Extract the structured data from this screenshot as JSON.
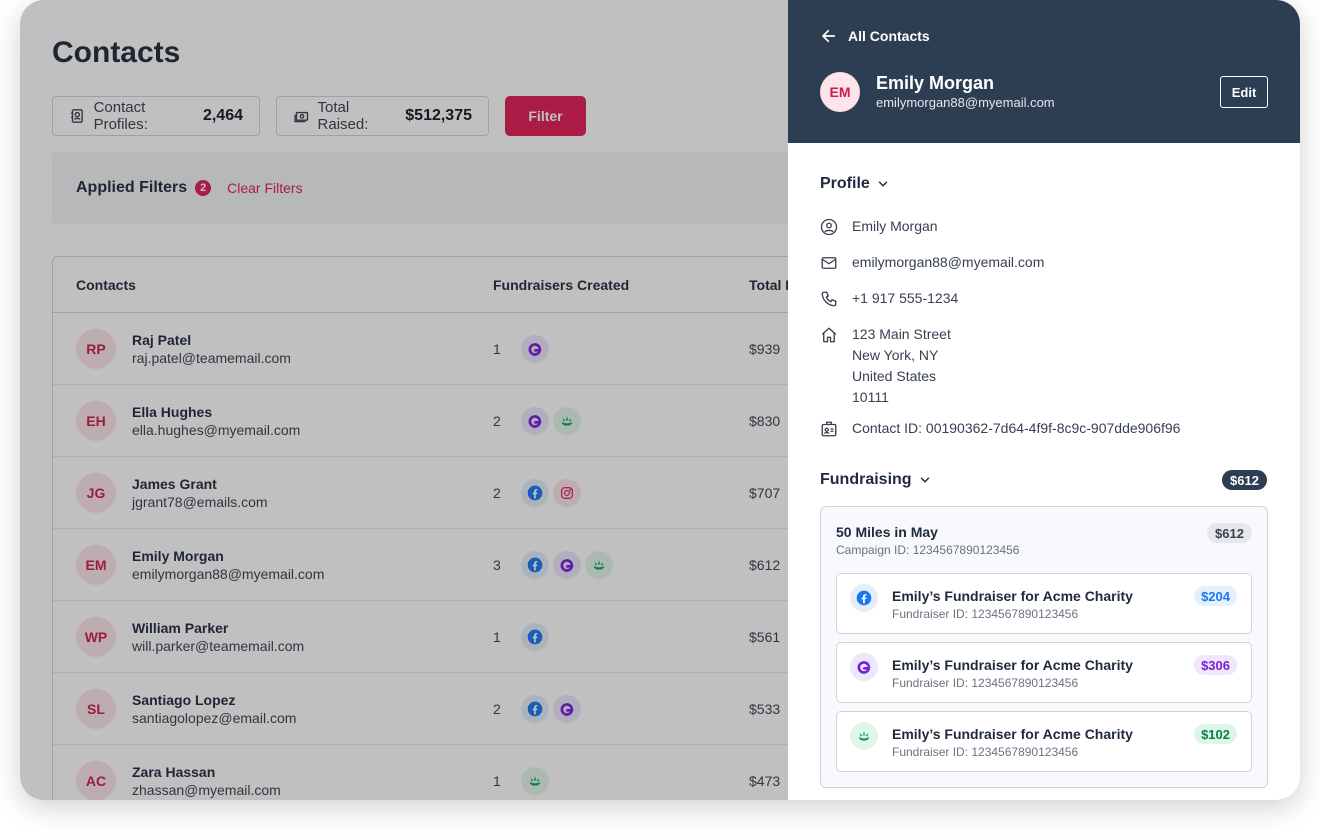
{
  "page": {
    "title": "Contacts",
    "stats": {
      "profiles_label": "Contact Profiles:",
      "profiles_value": "2,464",
      "raised_label": "Total Raised:",
      "raised_value": "$512,375"
    },
    "filter_button": "Filter",
    "applied_filters": {
      "label": "Applied Filters",
      "count": "2",
      "clear": "Clear Filters"
    },
    "table": {
      "headers": {
        "contacts": "Contacts",
        "fundraisers": "Fundraisers Created",
        "total": "Total R"
      },
      "rows": [
        {
          "initials": "RP",
          "name": "Raj Patel",
          "email": "raj.patel@teamemail.com",
          "count": "1",
          "platforms": [
            "gg"
          ],
          "total": "$939"
        },
        {
          "initials": "EH",
          "name": "Ella Hughes",
          "email": "ella.hughes@myemail.com",
          "count": "2",
          "platforms": [
            "gg",
            "gf"
          ],
          "total": "$830"
        },
        {
          "initials": "JG",
          "name": "James Grant",
          "email": "jgrant78@emails.com",
          "count": "2",
          "platforms": [
            "fb",
            "ig"
          ],
          "total": "$707"
        },
        {
          "initials": "EM",
          "name": "Emily Morgan",
          "email": "emilymorgan88@myemail.com",
          "count": "3",
          "platforms": [
            "fb",
            "gg",
            "gf"
          ],
          "total": "$612"
        },
        {
          "initials": "WP",
          "name": "William Parker",
          "email": "will.parker@teamemail.com",
          "count": "1",
          "platforms": [
            "fb"
          ],
          "total": "$561"
        },
        {
          "initials": "SL",
          "name": "Santiago Lopez",
          "email": "santiagolopez@email.com",
          "count": "2",
          "platforms": [
            "fb",
            "gg"
          ],
          "total": "$533"
        },
        {
          "initials": "AC",
          "name": "Zara Hassan",
          "email": "zhassan@myemail.com",
          "count": "1",
          "platforms": [
            "gf"
          ],
          "total": "$473"
        }
      ]
    }
  },
  "panel": {
    "back_label": "All Contacts",
    "initials": "EM",
    "name": "Emily Morgan",
    "email": "emilymorgan88@myemail.com",
    "edit_label": "Edit",
    "profile_title": "Profile",
    "profile": {
      "name": "Emily Morgan",
      "email": "emilymorgan88@myemail.com",
      "phone": "+1 917 555-1234",
      "address_lines": [
        "123 Main Street",
        "New York, NY",
        "United States",
        "10111"
      ],
      "contact_id": "Contact ID: 00190362-7d64-4f9f-8c9c-907dde906f96"
    },
    "fundraising_title": "Fundraising",
    "fundraising_total": "$612",
    "campaign": {
      "title": "50 Miles in May",
      "id": "Campaign ID: 1234567890123456",
      "amount": "$612",
      "fundraisers": [
        {
          "platform": "fb",
          "title": "Emily’s Fundraiser for Acme Charity",
          "id": "Fundraiser ID: 1234567890123456",
          "amount": "$204"
        },
        {
          "platform": "gg",
          "title": "Emily’s Fundraiser for Acme Charity",
          "id": "Fundraiser ID: 1234567890123456",
          "amount": "$306"
        },
        {
          "platform": "gf",
          "title": "Emily’s Fundraiser for Acme Charity",
          "id": "Fundraiser ID: 1234567890123456",
          "amount": "$102"
        }
      ]
    }
  },
  "colors": {
    "accent": "#e11d55",
    "panel_header": "#2d3e52",
    "facebook": "#1877f2",
    "platform_g": "#7b1fd6",
    "platform_leaf": "#02a95c"
  }
}
